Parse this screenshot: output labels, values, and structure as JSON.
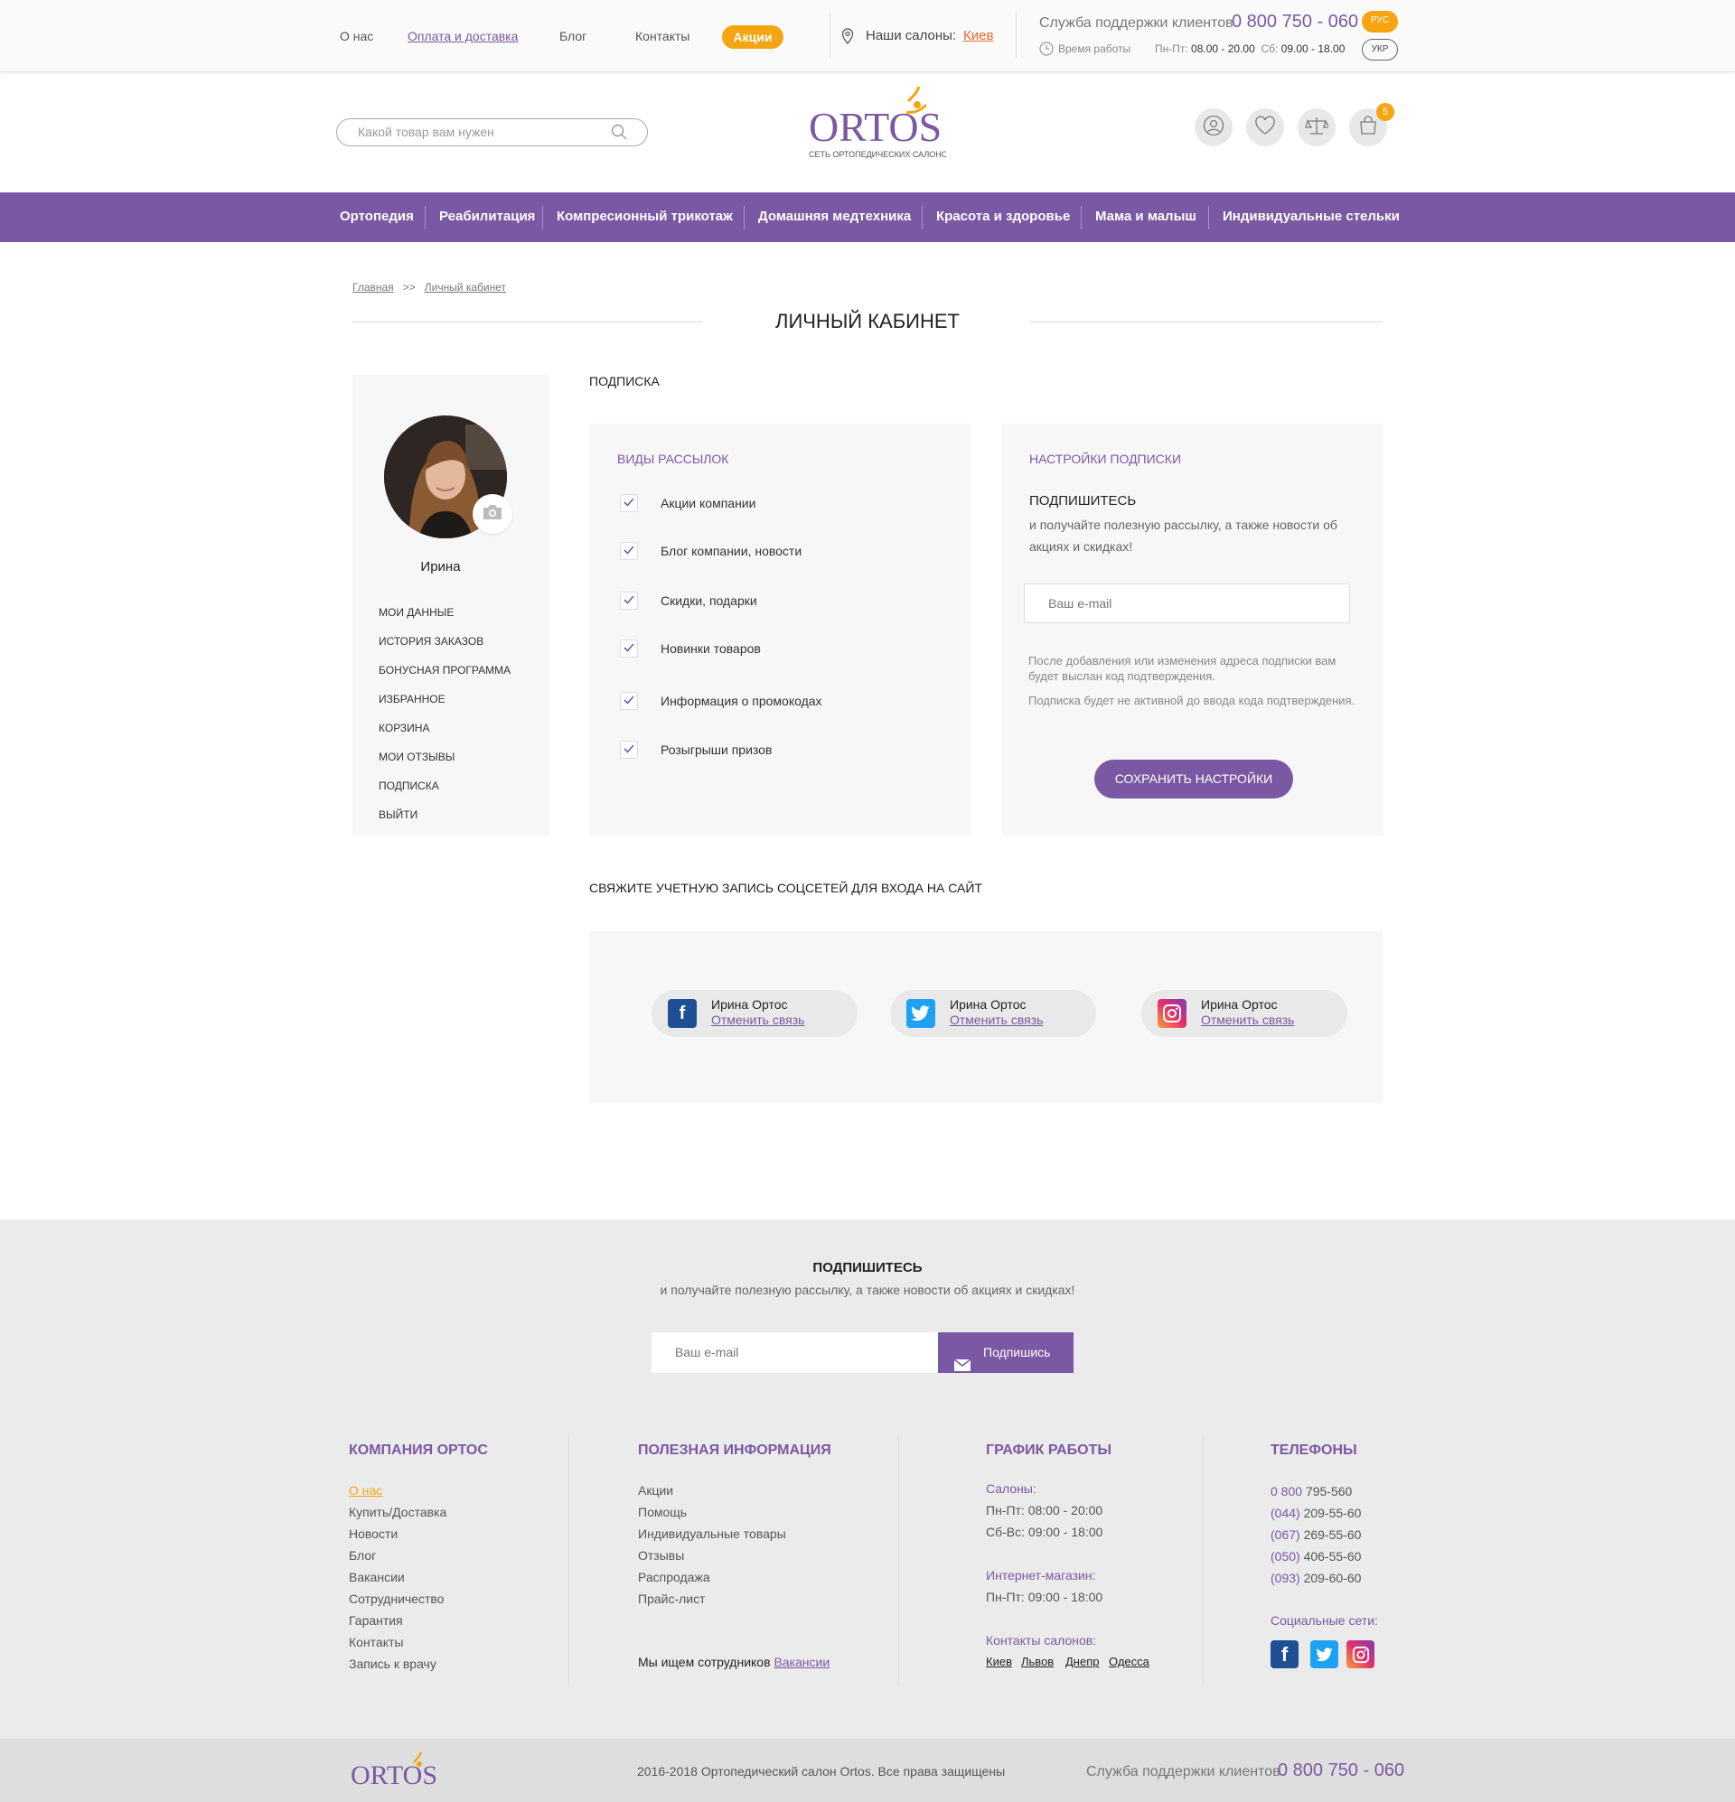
{
  "topbar": {
    "nav": [
      "О нас",
      "Оплата и доставка",
      "Блог",
      "Контакты"
    ],
    "promo": "Акции",
    "salons_label": "Наши салоны:",
    "salons_city": "Киев",
    "support_label": "Служба поддержки клиентов",
    "support_phone": "0 800 750 - 060",
    "worktime_label": "Время работы",
    "hours_weekday_label": "Пн-Пт:",
    "hours_weekday": "08.00 - 20.00",
    "hours_sat_label": "Сб:",
    "hours_sat": "09.00 - 18.00",
    "lang_ru": "РУС",
    "lang_ua": "УКР"
  },
  "header": {
    "search_placeholder": "Какой товар вам нужен",
    "logo_text": "ORTOS",
    "logo_sub": "СЕТЬ ОРТОПЕДИЧЕСКИХ САЛОНОВ",
    "cart_count": "5"
  },
  "menu": [
    "Ортопедия",
    "Реабилитация",
    "Компресионный трикотаж",
    "Домашняя медтехника",
    "Красота и здоровье",
    "Мама и малыш",
    "Индивидуальные стельки"
  ],
  "breadcrumb": {
    "home": "Главная",
    "sep": ">>",
    "current": "Личный кабинет"
  },
  "page_title": "ЛИЧНЫЙ КАБИНЕТ",
  "sidebar": {
    "user_name": "Ирина",
    "items": [
      "МОИ ДАННЫЕ",
      "ИСТОРИЯ ЗАКАЗОВ",
      "БОНУСНАЯ ПРОГРАММА",
      "ИЗБРАННОЕ",
      "КОРЗИНА",
      "МОИ ОТЗЫВЫ",
      "ПОДПИСКА",
      "ВЫЙТИ"
    ]
  },
  "subscription": {
    "section_title": "ПОДПИСКА",
    "types_title": "ВИДЫ РАССЫЛОК",
    "types": [
      "Акции компании",
      "Блог компании, новости",
      "Скидки, подарки",
      "Новинки товаров",
      "Информация о промокодах",
      "Розыгрыши призов"
    ],
    "settings_title": "НАСТРОЙКИ ПОДПИСКИ",
    "subscribe_heading": "ПОДПИШИТЕСЬ",
    "subscribe_text": "и получайте полезную рассылку, а также новости об акциях и скидках!",
    "email_placeholder": "Ваш e-mail",
    "note1": "После добавления или изменения адреса подписки вам будет выслан код подтверждения.",
    "note2": "Подписка будет не активной до ввода кода подтверждения.",
    "save_label": "СОХРАНИТЬ НАСТРОЙКИ"
  },
  "social": {
    "section_title": "СВЯЖИТЕ УЧЕТНУЮ ЗАПИСЬ СОЦСЕТЕЙ ДЛЯ ВХОДА НА САЙТ",
    "accounts": [
      {
        "network": "facebook",
        "name": "Ирина Ортос",
        "unlink": "Отменить связь",
        "color": "#1f4f96"
      },
      {
        "network": "twitter",
        "name": "Ирина Ортос",
        "unlink": "Отменить связь",
        "color": "#1da1f2"
      },
      {
        "network": "instagram",
        "name": "Ирина Ортос",
        "unlink": "Отменить связь",
        "color": "#c13584"
      }
    ]
  },
  "footer": {
    "subscribe_title": "ПОДПИШИТЕСЬ",
    "subscribe_text": "и получайте полезную рассылку, а также новости об акциях и скидках!",
    "email_placeholder": "Ваш e-mail",
    "subscribe_button": "Подпишись",
    "company_title": "КОМПАНИЯ ОРТОС",
    "company_links": [
      "О нас",
      "Купить/Доставка",
      "Новости",
      "Блог",
      "Вакансии",
      "Сотрудничество",
      "Гарантия",
      "Контакты",
      "Запись к врачу"
    ],
    "info_title": "ПОЛЕЗНАЯ ИНФОРМАЦИЯ",
    "info_links": [
      "Акции",
      "Помощь",
      "Индивидуальные товары",
      "Отзывы",
      "Распродажа",
      "Прайс-лист"
    ],
    "hiring_text": "Мы ищем сотрудников",
    "hiring_link": "Вакансии",
    "schedule_title": "ГРАФИК РАБОТЫ",
    "salons_label": "Салоны:",
    "salons_weekday": "Пн-Пт: 08:00 - 20:00",
    "salons_weekend": "Сб-Вс: 09:00 - 18:00",
    "online_label": "Интернет-магазин:",
    "online_hours": "Пн-Пт: 09:00 - 18:00",
    "contacts_label": "Контакты салонов:",
    "cities": [
      "Киев",
      "Львов",
      "Днепр",
      "Одесса"
    ],
    "phones_title": "ТЕЛЕФОНЫ",
    "phones": [
      {
        "code": "0 800",
        "num": "795-560"
      },
      {
        "code": "(044)",
        "num": "209-55-60"
      },
      {
        "code": "(067)",
        "num": "269-55-60"
      },
      {
        "code": "(050)",
        "num": "406-55-60"
      },
      {
        "code": "(093)",
        "num": "209-60-60"
      }
    ],
    "social_label": "Социальные сети:",
    "copyright": "2016-2018  Ортопедический салон Ortos. Все права защищены",
    "support_label": "Служба поддержки клиентов",
    "support_phone": "0 800 750 - 060"
  },
  "colors": {
    "brand": "#7b58a3",
    "accent": "#f5a511"
  }
}
